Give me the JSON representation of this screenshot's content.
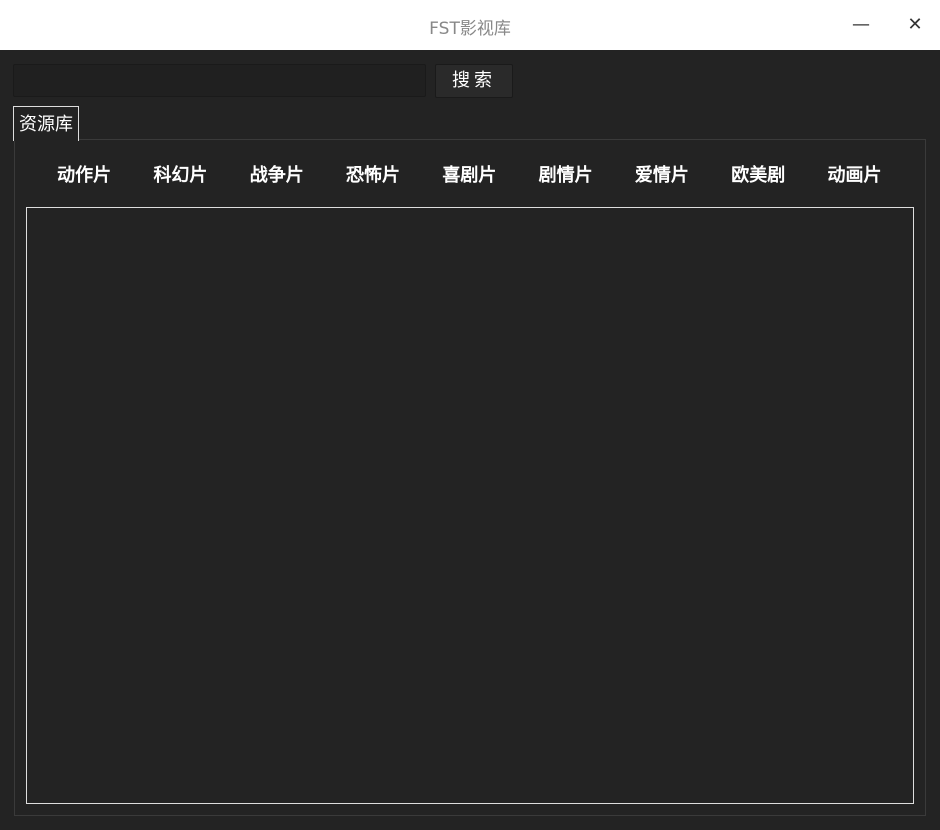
{
  "window": {
    "title": "FST影视库",
    "minimize": "—",
    "close": "✕"
  },
  "search": {
    "value": "",
    "placeholder": "",
    "button": "搜索"
  },
  "tabs": [
    {
      "label": "资源库"
    }
  ],
  "categories": [
    "动作片",
    "科幻片",
    "战争片",
    "恐怖片",
    "喜剧片",
    "剧情片",
    "爱情片",
    "欧美剧",
    "动画片"
  ]
}
